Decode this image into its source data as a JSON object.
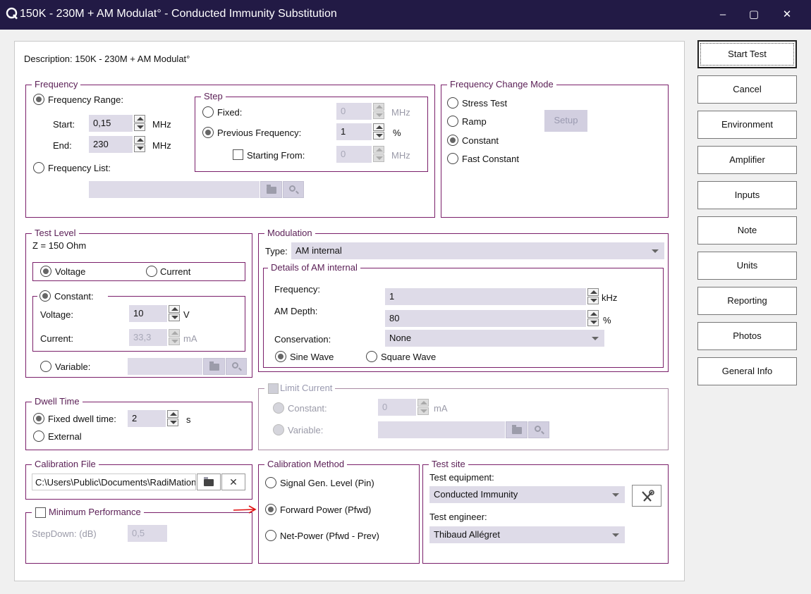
{
  "window": {
    "title": "150K - 230M + AM Modulat° - Conducted Immunity Substitution",
    "minimize": "‒",
    "maximize": "▢",
    "close": "✕"
  },
  "description": {
    "label": "Description:",
    "value": "150K - 230M + AM Modulat°"
  },
  "frequency": {
    "legend": "Frequency",
    "range_label": "Frequency Range:",
    "start_label": "Start:",
    "start_value": "0,15",
    "start_unit": "MHz",
    "end_label": "End:",
    "end_value": "230",
    "end_unit": "MHz",
    "list_label": "Frequency List:",
    "list_value": ""
  },
  "step": {
    "legend": "Step",
    "fixed_label": "Fixed:",
    "fixed_value": "0",
    "fixed_unit": "MHz",
    "previous_label": "Previous Frequency:",
    "previous_value": "1",
    "previous_unit": "%",
    "starting_label": "Starting From:",
    "starting_value": "0",
    "starting_unit": "MHz"
  },
  "change_mode": {
    "legend": "Frequency Change Mode",
    "options": [
      "Stress Test",
      "Ramp",
      "Constant",
      "Fast Constant"
    ],
    "selected": "Constant",
    "setup_label": "Setup"
  },
  "test_level": {
    "legend": "Test Level",
    "impedance": "Z = 150 Ohm",
    "voltage_label": "Voltage",
    "current_label": "Current",
    "constant_label": "Constant:",
    "c_voltage_label": "Voltage:",
    "c_voltage_value": "10",
    "c_voltage_unit": "V",
    "c_current_label": "Current:",
    "c_current_value": "33,3",
    "c_current_unit": "mA",
    "variable_label": "Variable:"
  },
  "modulation": {
    "legend": "Modulation",
    "type_label": "Type:",
    "type_value": "AM internal",
    "details_legend": "Details of AM internal",
    "freq_label": "Frequency:",
    "freq_value": "1",
    "freq_unit": "kHz",
    "depth_label": "AM Depth:",
    "depth_value": "80",
    "depth_unit": "%",
    "conservation_label": "Conservation:",
    "conservation_value": "None",
    "sine_label": "Sine Wave",
    "square_label": "Square Wave"
  },
  "dwell": {
    "legend": "Dwell Time",
    "fixed_label": "Fixed dwell time:",
    "fixed_value": "2",
    "fixed_unit": "s",
    "external_label": "External"
  },
  "limit_current": {
    "legend": "Limit Current",
    "constant_label": "Constant:",
    "constant_value": "0",
    "constant_unit": "mA",
    "variable_label": "Variable:"
  },
  "calibration_file": {
    "legend": "Calibration File",
    "path": "C:\\Users\\Public\\Documents\\RadiMation"
  },
  "min_perf": {
    "legend": "Minimum Performance",
    "stepdown_label": "StepDown: (dB)",
    "stepdown_value": "0,5"
  },
  "calibration_method": {
    "legend": "Calibration Method",
    "options": [
      "Signal Gen. Level (Pin)",
      "Forward Power (Pfwd)",
      "Net-Power (Pfwd - Prev)"
    ],
    "selected": "Forward Power (Pfwd)"
  },
  "test_site": {
    "legend": "Test site",
    "equipment_label": "Test equipment:",
    "equipment_value": "Conducted Immunity",
    "engineer_label": "Test engineer:",
    "engineer_value": "Thibaud Allégret"
  },
  "sidebar": [
    "Start Test",
    "Cancel",
    "Environment",
    "Amplifier",
    "Inputs",
    "Note",
    "Units",
    "Reporting",
    "Photos",
    "General Info"
  ],
  "colors": {
    "titlebar": "#221a45",
    "group_border": "#7a1f6a",
    "legend_text": "#5a1e55",
    "arrow": "#e01010"
  }
}
